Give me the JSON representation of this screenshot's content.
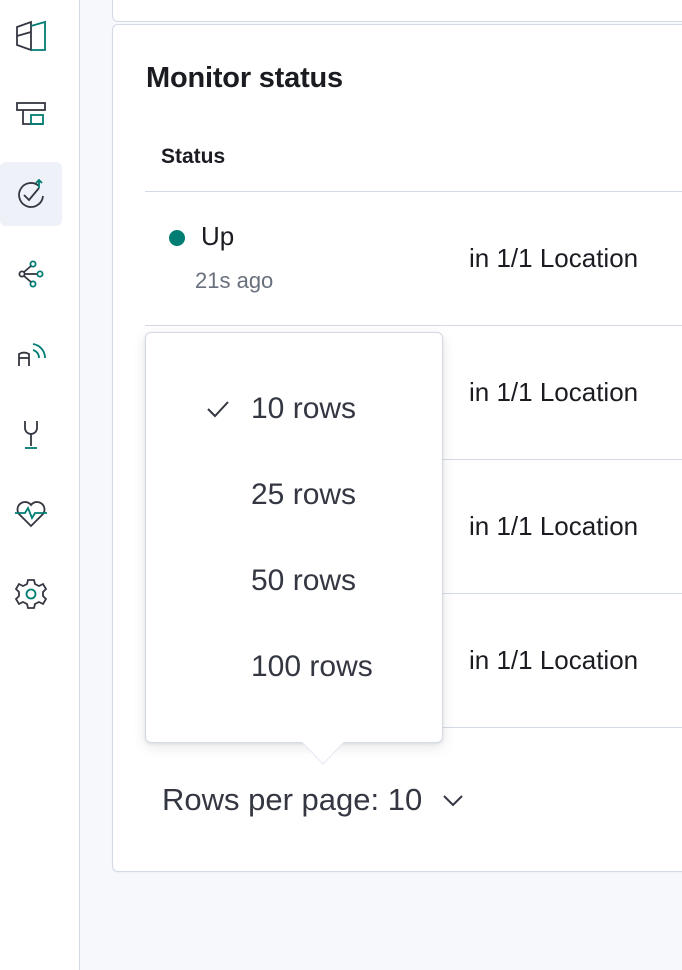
{
  "sidebar": {
    "items": [
      {
        "icon": "dashboard-icon"
      },
      {
        "icon": "canvas-icon"
      },
      {
        "icon": "uptime-icon",
        "active": true
      },
      {
        "icon": "apm-icon"
      },
      {
        "icon": "observability-icon"
      },
      {
        "icon": "dev-tools-icon"
      },
      {
        "icon": "heartbeat-icon"
      },
      {
        "icon": "settings-icon"
      }
    ]
  },
  "monitor": {
    "title": "Monitor status",
    "column_status": "Status",
    "rows": [
      {
        "status": "Up",
        "time": "21s ago",
        "location": "in 1/1 Location",
        "status_color": "#017d73"
      },
      {
        "location": "in 1/1 Location"
      },
      {
        "location": "in 1/1 Location"
      },
      {
        "location": "in 1/1 Location"
      }
    ]
  },
  "rows_popover": {
    "options": [
      {
        "label": "10 rows",
        "selected": true
      },
      {
        "label": "25 rows",
        "selected": false
      },
      {
        "label": "50 rows",
        "selected": false
      },
      {
        "label": "100 rows",
        "selected": false
      }
    ]
  },
  "pagination": {
    "rows_per_page_label": "Rows per page: 10"
  },
  "colors": {
    "accent": "#017d73",
    "icon_dark": "#343741",
    "border": "#d3dae6"
  }
}
